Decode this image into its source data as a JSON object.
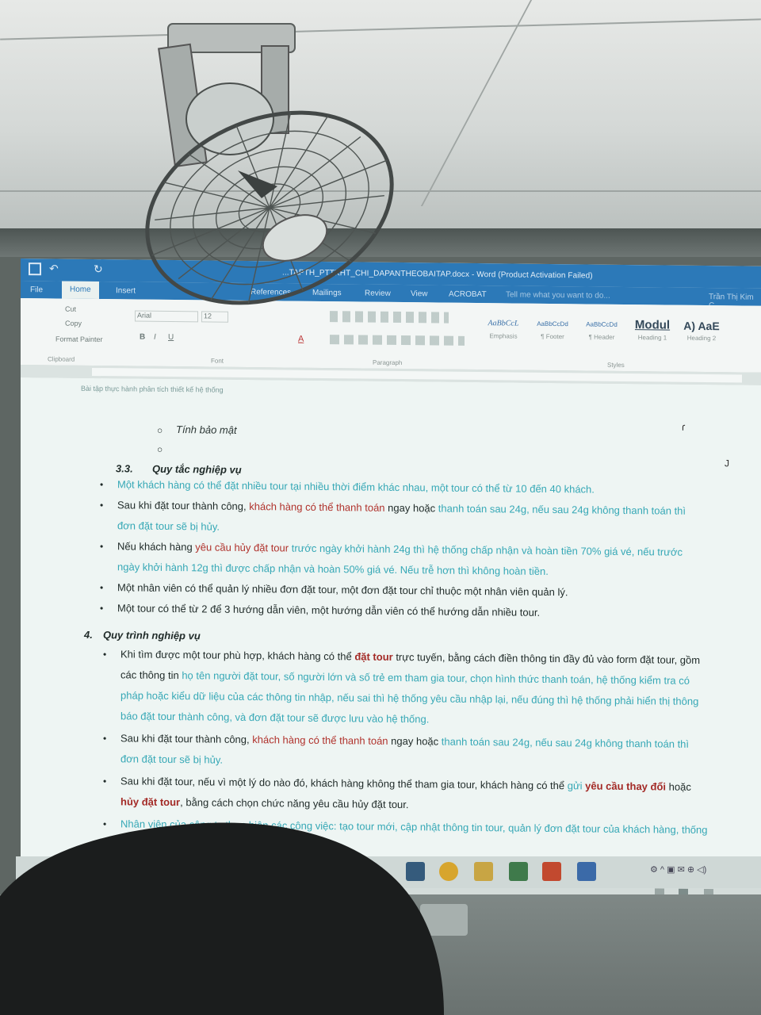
{
  "window": {
    "title": "...TAPTH_PTTKHT_CHI_DAPANTHEOBAITAP.docx - Word (Product Activation Failed)",
    "user": "Trần Thị Kim C"
  },
  "tabs": [
    "File",
    "Home",
    "Insert",
    "References",
    "Mailings",
    "Review",
    "View",
    "ACROBAT"
  ],
  "tell_me": "Tell me what you want to do...",
  "ribbon": {
    "clipboard": {
      "cut": "Cut",
      "copy": "Copy",
      "format_painter": "Format Painter",
      "label": "Clipboard"
    },
    "font": {
      "name": "Arial",
      "size": "12",
      "label": "Font"
    },
    "paragraph_label": "Paragraph",
    "styles_label": "Styles",
    "styles": [
      {
        "sample": "AaBbCcL",
        "name": "Emphasis"
      },
      {
        "sample": "AaBbCcDd",
        "name": "¶ Footer"
      },
      {
        "sample": "AaBbCcDd",
        "name": "¶ Header"
      },
      {
        "sample": "Modul",
        "name": "Heading 1"
      },
      {
        "sample": "A) AaE",
        "name": "Heading 2"
      }
    ]
  },
  "document": {
    "header_text": "Bài tập thực hành phân tích thiết kế hệ thống",
    "item_tinh_bao_mat": "Tính bảo mật",
    "section_33_num": "3.3.",
    "section_33_title": "Quy tắc nghiệp vụ",
    "rules": [
      {
        "plain": "",
        "parts": [
          [
            "cyan",
            "Một khách hàng có thể đặt nhiều tour tại nhiều thời điểm khác nhau, một tour có thể từ 10 đến 40 khách."
          ]
        ]
      },
      {
        "parts": [
          [
            "plain",
            "Sau khi đặt tour thành công, "
          ],
          [
            "red",
            "khách hàng có thể thanh toán"
          ],
          [
            "plain",
            " ngay hoặc "
          ],
          [
            "cyan",
            "thanh toán sau 24g, nếu sau 24g không thanh toán thì"
          ]
        ],
        "cont": "đơn đặt tour sẽ bị hủy."
      },
      {
        "parts": [
          [
            "plain",
            "Nếu khách hàng "
          ],
          [
            "red",
            "yêu cầu hủy đặt tour"
          ],
          [
            "cyan",
            " trước ngày khởi hành 24g thì hệ thống chấp nhận và hoàn tiền 70% giá vé, nếu trước"
          ]
        ],
        "cont": "ngày khởi hành 12g thì được chấp nhận và hoàn 50% giá vé. Nếu trễ hơn thì không hoàn tiền."
      },
      {
        "parts": [
          [
            "plain",
            "Một nhân viên có thể quản lý nhiều đơn đặt tour, một đơn đặt tour chỉ thuộc một nhân viên quản lý."
          ]
        ]
      },
      {
        "parts": [
          [
            "plain",
            "Một tour có thể từ 2 để 3 hướng dẫn viên, một hướng dẫn viên có thể hướng dẫn nhiều tour."
          ]
        ]
      }
    ],
    "section_4_num": "4.",
    "section_4_title": "Quy trình nghiệp vụ",
    "process": [
      {
        "parts": [
          [
            "plain",
            "Khi tìm được một tour phù hợp, khách hàng có thể "
          ],
          [
            "redb",
            "đặt tour"
          ],
          [
            "plain",
            " trực tuyến, bằng cách điền thông tin đầy đủ vào form đặt tour, gồm"
          ]
        ],
        "conts": [
          [
            [
              "plain",
              "các thông tin "
            ],
            [
              "cyan",
              "họ tên người đặt tour, số người lớn và số trẻ em tham gia tour, chọn hình thức thanh toán, hệ thống kiểm tra có"
            ]
          ],
          [
            [
              "cyan",
              "pháp hoặc kiểu dữ liệu của các thông tin nhập, nếu sai thì hệ thống yêu cầu nhập lại, nếu đúng thì hệ thống phải hiển thị thông"
            ]
          ],
          [
            [
              "cyan",
              "báo đặt tour thành công, và đơn đặt tour sẽ được lưu vào hệ thống."
            ]
          ]
        ]
      },
      {
        "parts": [
          [
            "plain",
            "Sau khi đặt tour thành công, "
          ],
          [
            "red",
            "khách hàng có thể thanh toán"
          ],
          [
            "plain",
            " ngay hoặc "
          ],
          [
            "cyan",
            "thanh toán sau 24g, nếu sau 24g không thanh toán thì"
          ]
        ],
        "conts": [
          [
            [
              "cyan",
              "đơn đặt tour sẽ bị hủy."
            ]
          ]
        ]
      },
      {
        "parts": [
          [
            "plain",
            "Sau khi đặt tour, nếu vì một lý do nào đó, khách hàng không thể tham gia tour, khách hàng có thể "
          ],
          [
            "cyan",
            "gửi "
          ],
          [
            "redb",
            "yêu cầu thay đổi"
          ],
          [
            "plain",
            " hoặc"
          ]
        ],
        "conts": [
          [
            [
              "redb",
              "hủy đặt tour"
            ],
            [
              "plain",
              ", bằng cách chọn chức năng yêu cầu hủy đặt tour."
            ]
          ]
        ]
      },
      {
        "parts": [
          [
            "cyan",
            "Nhân viên của công ty thực hiện các công việc: tạo tour mới, cập nhật thông tin tour, quản lý đơn đặt tour của khách hàng, thống"
          ]
        ]
      }
    ],
    "margin_marks": [
      "ɾ",
      "J"
    ]
  }
}
